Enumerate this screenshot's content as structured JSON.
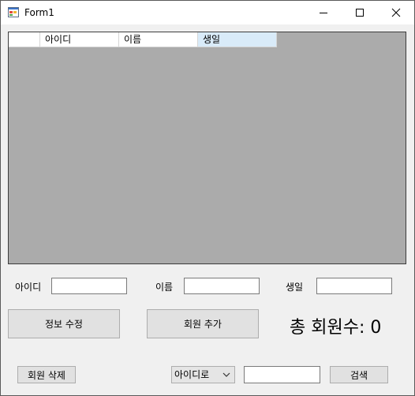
{
  "window": {
    "title": "Form1",
    "icon": "form-app-icon",
    "controls": [
      "minimize-icon",
      "maximize-icon",
      "close-icon"
    ]
  },
  "grid": {
    "columns": [
      "아이디",
      "이름",
      "생일"
    ],
    "rows": []
  },
  "form": {
    "id_label": "아이디",
    "id_value": "",
    "name_label": "이름",
    "name_value": "",
    "birthday_label": "생일",
    "birthday_value": ""
  },
  "buttons": {
    "edit_label": "정보 수정",
    "add_label": "회원 추가",
    "delete_label": "회원 삭제",
    "search_label": "검색"
  },
  "total_label": "총 회원수: 0",
  "search": {
    "mode_selected": "아이디로",
    "query_value": ""
  },
  "colors": {
    "grid_background": "#ababab",
    "selected_header": "#d9ebf9",
    "button_face": "#e1e1e1",
    "window_background": "#f0f0f0"
  }
}
